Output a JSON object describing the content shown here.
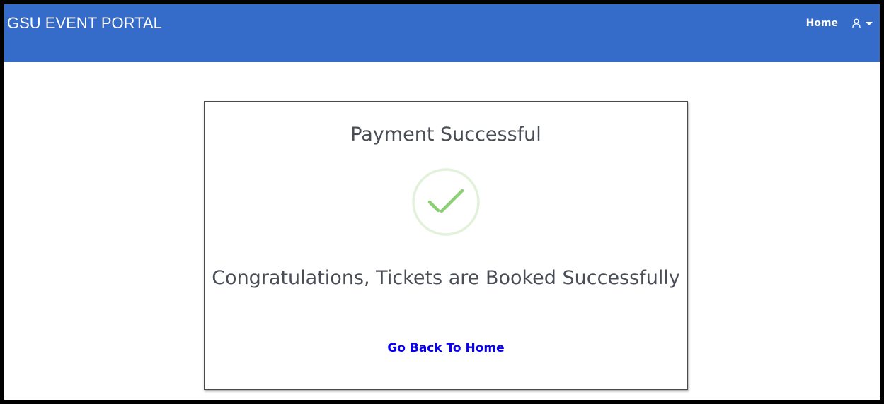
{
  "colors": {
    "navbar": "#356bc9",
    "text": "#494e56",
    "link": "#0a00f0",
    "check_stroke": "#8ccf74",
    "check_ring": "#e2f1da"
  },
  "navbar": {
    "brand": "GSU EVENT PORTAL",
    "home_label": "Home",
    "user_icon": "user-icon",
    "dropdown_icon": "caret-down-icon"
  },
  "card": {
    "title": "Payment Successful",
    "status_icon": "checkmark-circle-icon",
    "message": "Congratulations, Tickets are Booked Successfully",
    "link_label": "Go Back To Home"
  }
}
